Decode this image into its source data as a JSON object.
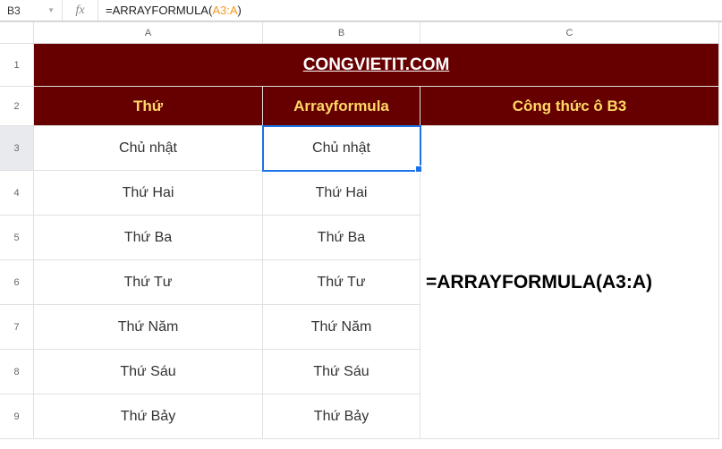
{
  "nameBox": "B3",
  "formulaBar": {
    "prefix": "=ARRAYFORMULA(",
    "ref": "A3:A",
    "suffix": ")"
  },
  "colHeaders": [
    "A",
    "B",
    "C"
  ],
  "rowLabels": [
    "1",
    "2",
    "3",
    "4",
    "5",
    "6",
    "7",
    "8",
    "9"
  ],
  "title": "CONGVIETIT.COM",
  "headers": {
    "a": "Thứ",
    "b": "Arrayformula",
    "c": "Công thức ô B3"
  },
  "rows": [
    {
      "a": "Chủ nhật",
      "b": "Chủ nhật"
    },
    {
      "a": "Thứ Hai",
      "b": "Thứ Hai"
    },
    {
      "a": "Thứ Ba",
      "b": "Thứ Ba"
    },
    {
      "a": "Thứ Tư",
      "b": "Thứ Tư"
    },
    {
      "a": "Thứ Năm",
      "b": "Thứ Năm"
    },
    {
      "a": "Thứ Sáu",
      "b": "Thứ Sáu"
    },
    {
      "a": "Thứ Bảy",
      "b": "Thứ Bảy"
    }
  ],
  "bigFormula": "=ARRAYFORMULA(A3:A)"
}
